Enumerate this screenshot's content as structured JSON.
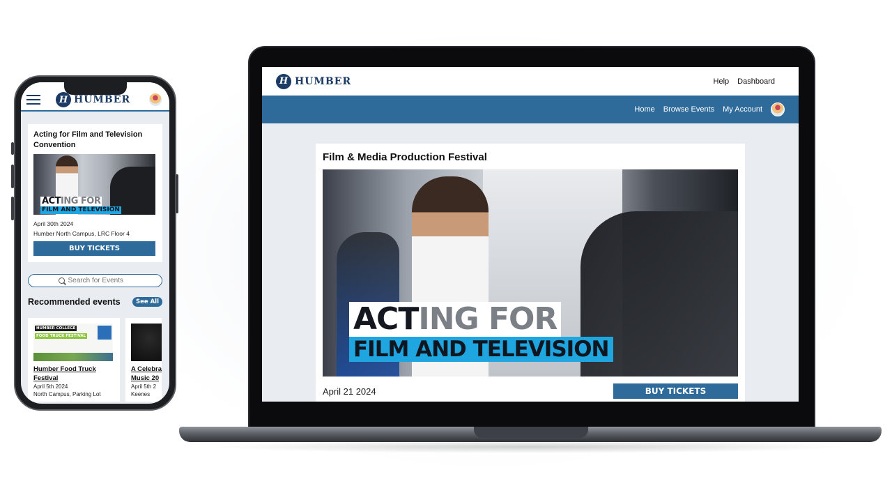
{
  "brand": {
    "logo_text": "HUMBER",
    "logo_mark": "H"
  },
  "colors": {
    "primary": "#2f6b9a",
    "brand_navy": "#1b3a64",
    "accent_blue": "#1fa6e0"
  },
  "desktop": {
    "topbar": {
      "help": "Help",
      "dashboard": "Dashboard"
    },
    "nav": {
      "home": "Home",
      "browse": "Browse Events",
      "account": "My Account"
    },
    "event": {
      "title": "Film & Media Production Festival",
      "hero_line1_dark": "ACT",
      "hero_line1_grey": "ING FOR",
      "hero_line2": "FILM AND TELEVISION",
      "date": "April 21 2024",
      "buy_label": "BUY TICKETS"
    }
  },
  "mobile": {
    "featured": {
      "title": "Acting for Film and Television Convention",
      "hero_line1_dark": "ACT",
      "hero_line1_grey": "ING FOR",
      "hero_line2": "FILM AND TELEVISION",
      "date": "April 30th 2024",
      "location": "Humber North Campus, LRC Floor 4",
      "buy_label": "BUY TICKETS"
    },
    "search": {
      "placeholder": "Search for Events"
    },
    "recommended": {
      "heading": "Recommended events",
      "see_all": "See All",
      "items": [
        {
          "title_line1": "Humber Food Truck",
          "title_line2": "Festival",
          "date": "April 5th 2024",
          "location": "North Campus, Parking Lot",
          "thumb_tag1": "HUMBER COLLEGE",
          "thumb_tag2": "FOOD TRUCK FESTIVAL"
        },
        {
          "title_line1": "A Celebra",
          "title_line2": "Music 20",
          "date": "April 5th 2",
          "location": "Keenes"
        }
      ]
    }
  },
  "icons": {
    "menu": "hamburger-icon",
    "search": "search-icon",
    "avatar": "user-avatar"
  }
}
